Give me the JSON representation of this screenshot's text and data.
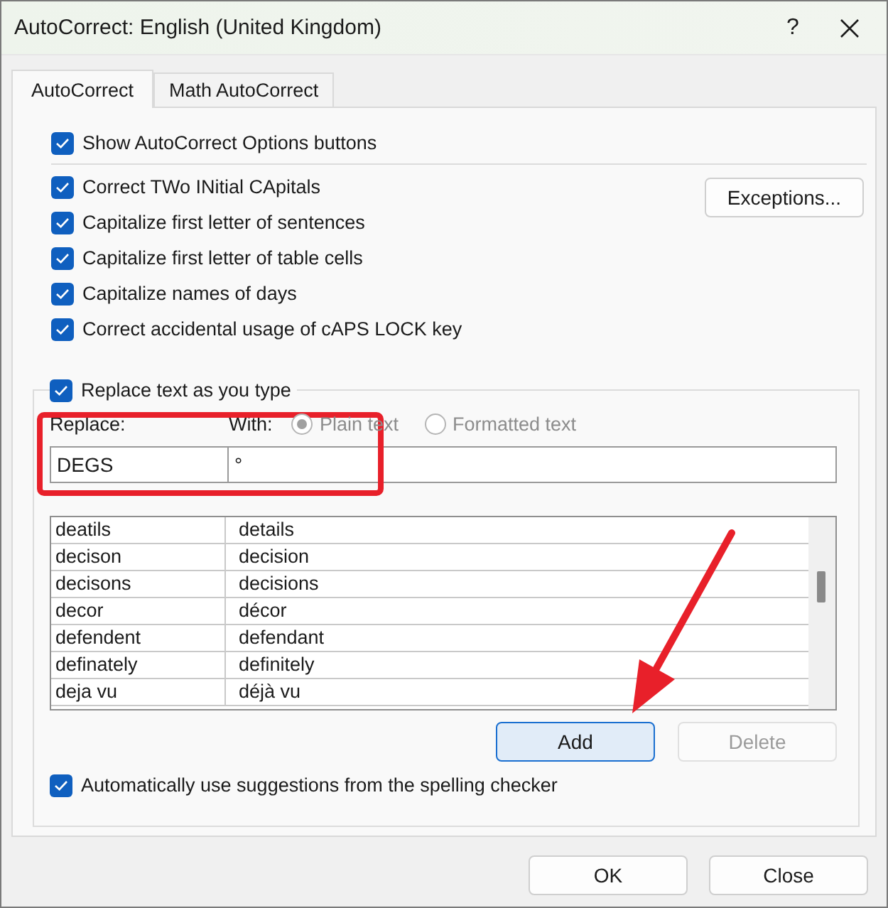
{
  "window": {
    "title": "AutoCorrect: English (United Kingdom)",
    "help_button": "?"
  },
  "tabs": [
    {
      "label": "AutoCorrect",
      "selected": true
    },
    {
      "label": "Math AutoCorrect",
      "selected": false
    }
  ],
  "options": [
    {
      "label": "Show AutoCorrect Options buttons",
      "checked": true
    },
    {
      "label": "Correct TWo INitial CApitals",
      "checked": true
    },
    {
      "label": "Capitalize first letter of sentences",
      "checked": true
    },
    {
      "label": "Capitalize first letter of table cells",
      "checked": true
    },
    {
      "label": "Capitalize names of days",
      "checked": true
    },
    {
      "label": "Correct accidental usage of cAPS LOCK key",
      "checked": true
    }
  ],
  "exceptions_button": "Exceptions...",
  "replace_group": {
    "label": "Replace text as you type",
    "checked": true,
    "replace_label": "Replace:",
    "with_label": "With:",
    "replace_value": "DEGS",
    "with_value": "°",
    "format_options": [
      {
        "label": "Plain text",
        "selected": true,
        "disabled": true
      },
      {
        "label": "Formatted text",
        "selected": false,
        "disabled": true
      }
    ]
  },
  "entries": [
    {
      "replace": "deatils",
      "with": "details"
    },
    {
      "replace": "decison",
      "with": "decision"
    },
    {
      "replace": "decisons",
      "with": "decisions"
    },
    {
      "replace": "decor",
      "with": "décor"
    },
    {
      "replace": "defendent",
      "with": "defendant"
    },
    {
      "replace": "definately",
      "with": "definitely"
    },
    {
      "replace": "deja vu",
      "with": "déjà vu"
    }
  ],
  "add_button": {
    "label": "Add",
    "default": true
  },
  "delete_button": {
    "label": "Delete",
    "disabled": true
  },
  "auto_suggestions": {
    "label": "Automatically use suggestions from the spelling checker",
    "checked": true
  },
  "buttons": [
    "OK",
    "Close"
  ],
  "annotations": {
    "highlight_frame": true,
    "arrow": true
  }
}
